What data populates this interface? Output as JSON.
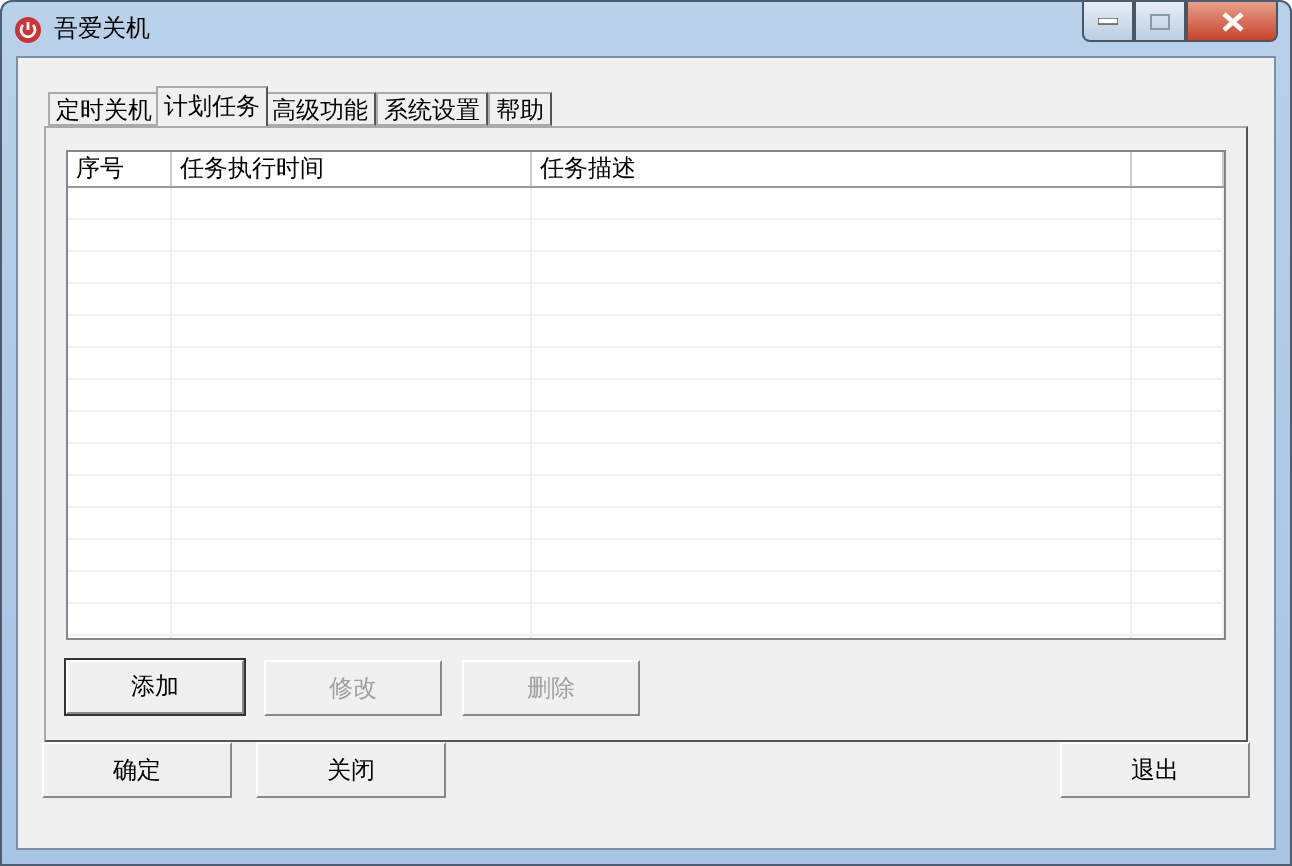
{
  "window": {
    "title": "吾爱关机"
  },
  "tabs": [
    {
      "label": "定时关机",
      "selected": false
    },
    {
      "label": "计划任务",
      "selected": true
    },
    {
      "label": "高级功能",
      "selected": false
    },
    {
      "label": "系统设置",
      "selected": false
    },
    {
      "label": "帮助",
      "selected": false
    }
  ],
  "table": {
    "columns": [
      "序号",
      "任务执行时间",
      "任务描述"
    ]
  },
  "task_buttons": [
    {
      "label": "添加",
      "disabled": false,
      "focused": true
    },
    {
      "label": "修改",
      "disabled": true,
      "focused": false
    },
    {
      "label": "删除",
      "disabled": true,
      "focused": false
    }
  ],
  "footer_buttons": [
    {
      "label": "确定"
    },
    {
      "label": "关闭"
    }
  ],
  "exit_button": {
    "label": "退出"
  }
}
